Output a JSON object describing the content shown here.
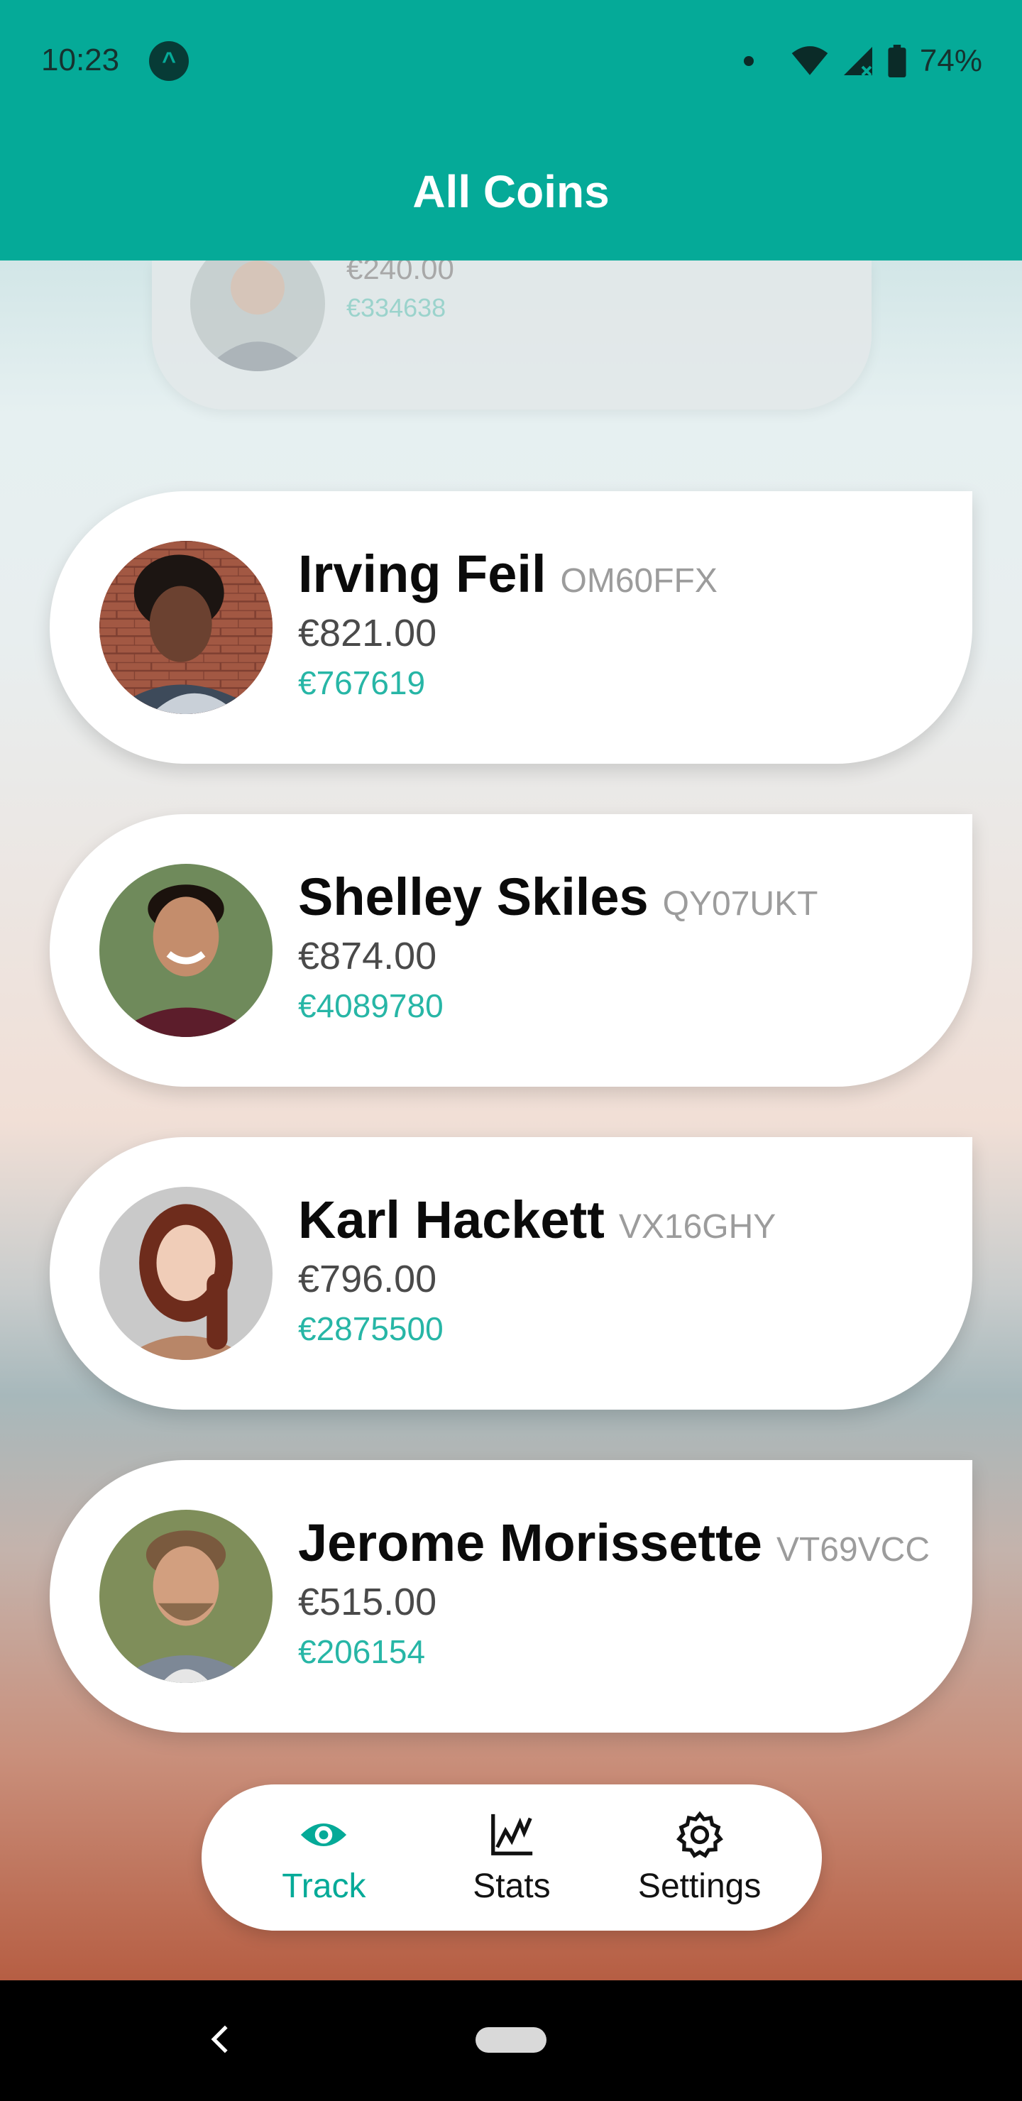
{
  "status_bar": {
    "time": "10:23",
    "app_icon_glyph": "^",
    "battery": "74%",
    "icons": [
      "wifi-icon",
      "cell-signal-icon",
      "battery-icon"
    ]
  },
  "app_bar": {
    "title": "All Coins"
  },
  "coins": [
    {
      "name": "",
      "code": "",
      "price": "€240.00",
      "volume": "€334638",
      "avatar": "avatar-partial"
    },
    {
      "name": "Irving Feil",
      "code": "OM60FFX",
      "price": "€821.00",
      "volume": "€767619",
      "avatar": "avatar-woman-curly-hair"
    },
    {
      "name": "Shelley Skiles",
      "code": "QY07UKT",
      "price": "€874.00",
      "volume": "€4089780",
      "avatar": "avatar-man-smiling"
    },
    {
      "name": "Karl Hackett",
      "code": "VX16GHY",
      "price": "€796.00",
      "volume": "€2875500",
      "avatar": "avatar-woman-red-hair"
    },
    {
      "name": "Jerome Morissette",
      "code": "VT69VCC",
      "price": "€515.00",
      "volume": "€206154",
      "avatar": "avatar-man-beard"
    }
  ],
  "bottom_nav": {
    "items": [
      {
        "label": "Track",
        "icon": "eye-icon",
        "active": true
      },
      {
        "label": "Stats",
        "icon": "chart-icon",
        "active": false
      },
      {
        "label": "Settings",
        "icon": "gear-icon",
        "active": false
      }
    ]
  },
  "colors": {
    "primary": "#05AA98",
    "volume_text": "#27b6a6",
    "card_bg": "#ffffff"
  }
}
